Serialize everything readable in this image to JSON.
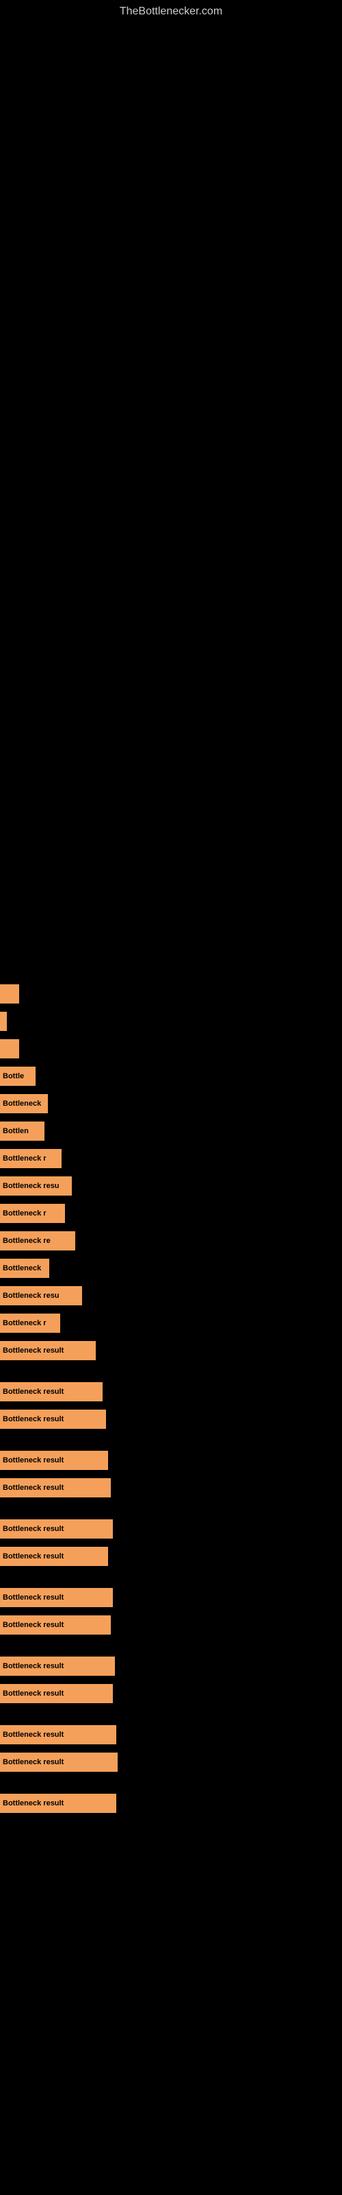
{
  "site": {
    "title": "TheBottlenecker.com"
  },
  "results": [
    {
      "id": 1,
      "label": "",
      "bar_class": "bar-1"
    },
    {
      "id": 2,
      "label": "",
      "bar_class": "bar-2"
    },
    {
      "id": 3,
      "label": "",
      "bar_class": "bar-3"
    },
    {
      "id": 4,
      "label": "Bottle",
      "bar_class": "bar-4"
    },
    {
      "id": 5,
      "label": "Bottleneck",
      "bar_class": "bar-5"
    },
    {
      "id": 6,
      "label": "Bottlen",
      "bar_class": "bar-6"
    },
    {
      "id": 7,
      "label": "Bottleneck r",
      "bar_class": "bar-7"
    },
    {
      "id": 8,
      "label": "Bottleneck resu",
      "bar_class": "bar-8"
    },
    {
      "id": 9,
      "label": "Bottleneck r",
      "bar_class": "bar-9"
    },
    {
      "id": 10,
      "label": "Bottleneck re",
      "bar_class": "bar-10"
    },
    {
      "id": 11,
      "label": "Bottleneck",
      "bar_class": "bar-11"
    },
    {
      "id": 12,
      "label": "Bottleneck resu",
      "bar_class": "bar-12"
    },
    {
      "id": 13,
      "label": "Bottleneck r",
      "bar_class": "bar-13"
    },
    {
      "id": 14,
      "label": "Bottleneck result",
      "bar_class": "bar-14"
    },
    {
      "id": 15,
      "label": "Bottleneck result",
      "bar_class": "bar-15"
    },
    {
      "id": 16,
      "label": "Bottleneck result",
      "bar_class": "bar-16"
    },
    {
      "id": 17,
      "label": "Bottleneck result",
      "bar_class": "bar-17"
    },
    {
      "id": 18,
      "label": "Bottleneck result",
      "bar_class": "bar-18"
    },
    {
      "id": 19,
      "label": "Bottleneck result",
      "bar_class": "bar-19"
    },
    {
      "id": 20,
      "label": "Bottleneck result",
      "bar_class": "bar-20"
    },
    {
      "id": 21,
      "label": "Bottleneck result",
      "bar_class": "bar-21"
    },
    {
      "id": 22,
      "label": "Bottleneck result",
      "bar_class": "bar-22"
    },
    {
      "id": 23,
      "label": "Bottleneck result",
      "bar_class": "bar-23"
    },
    {
      "id": 24,
      "label": "Bottleneck result",
      "bar_class": "bar-24"
    },
    {
      "id": 25,
      "label": "Bottleneck result",
      "bar_class": "bar-25"
    },
    {
      "id": 26,
      "label": "Bottleneck result",
      "bar_class": "bar-26"
    },
    {
      "id": 27,
      "label": "Bottleneck result",
      "bar_class": "bar-27"
    }
  ]
}
